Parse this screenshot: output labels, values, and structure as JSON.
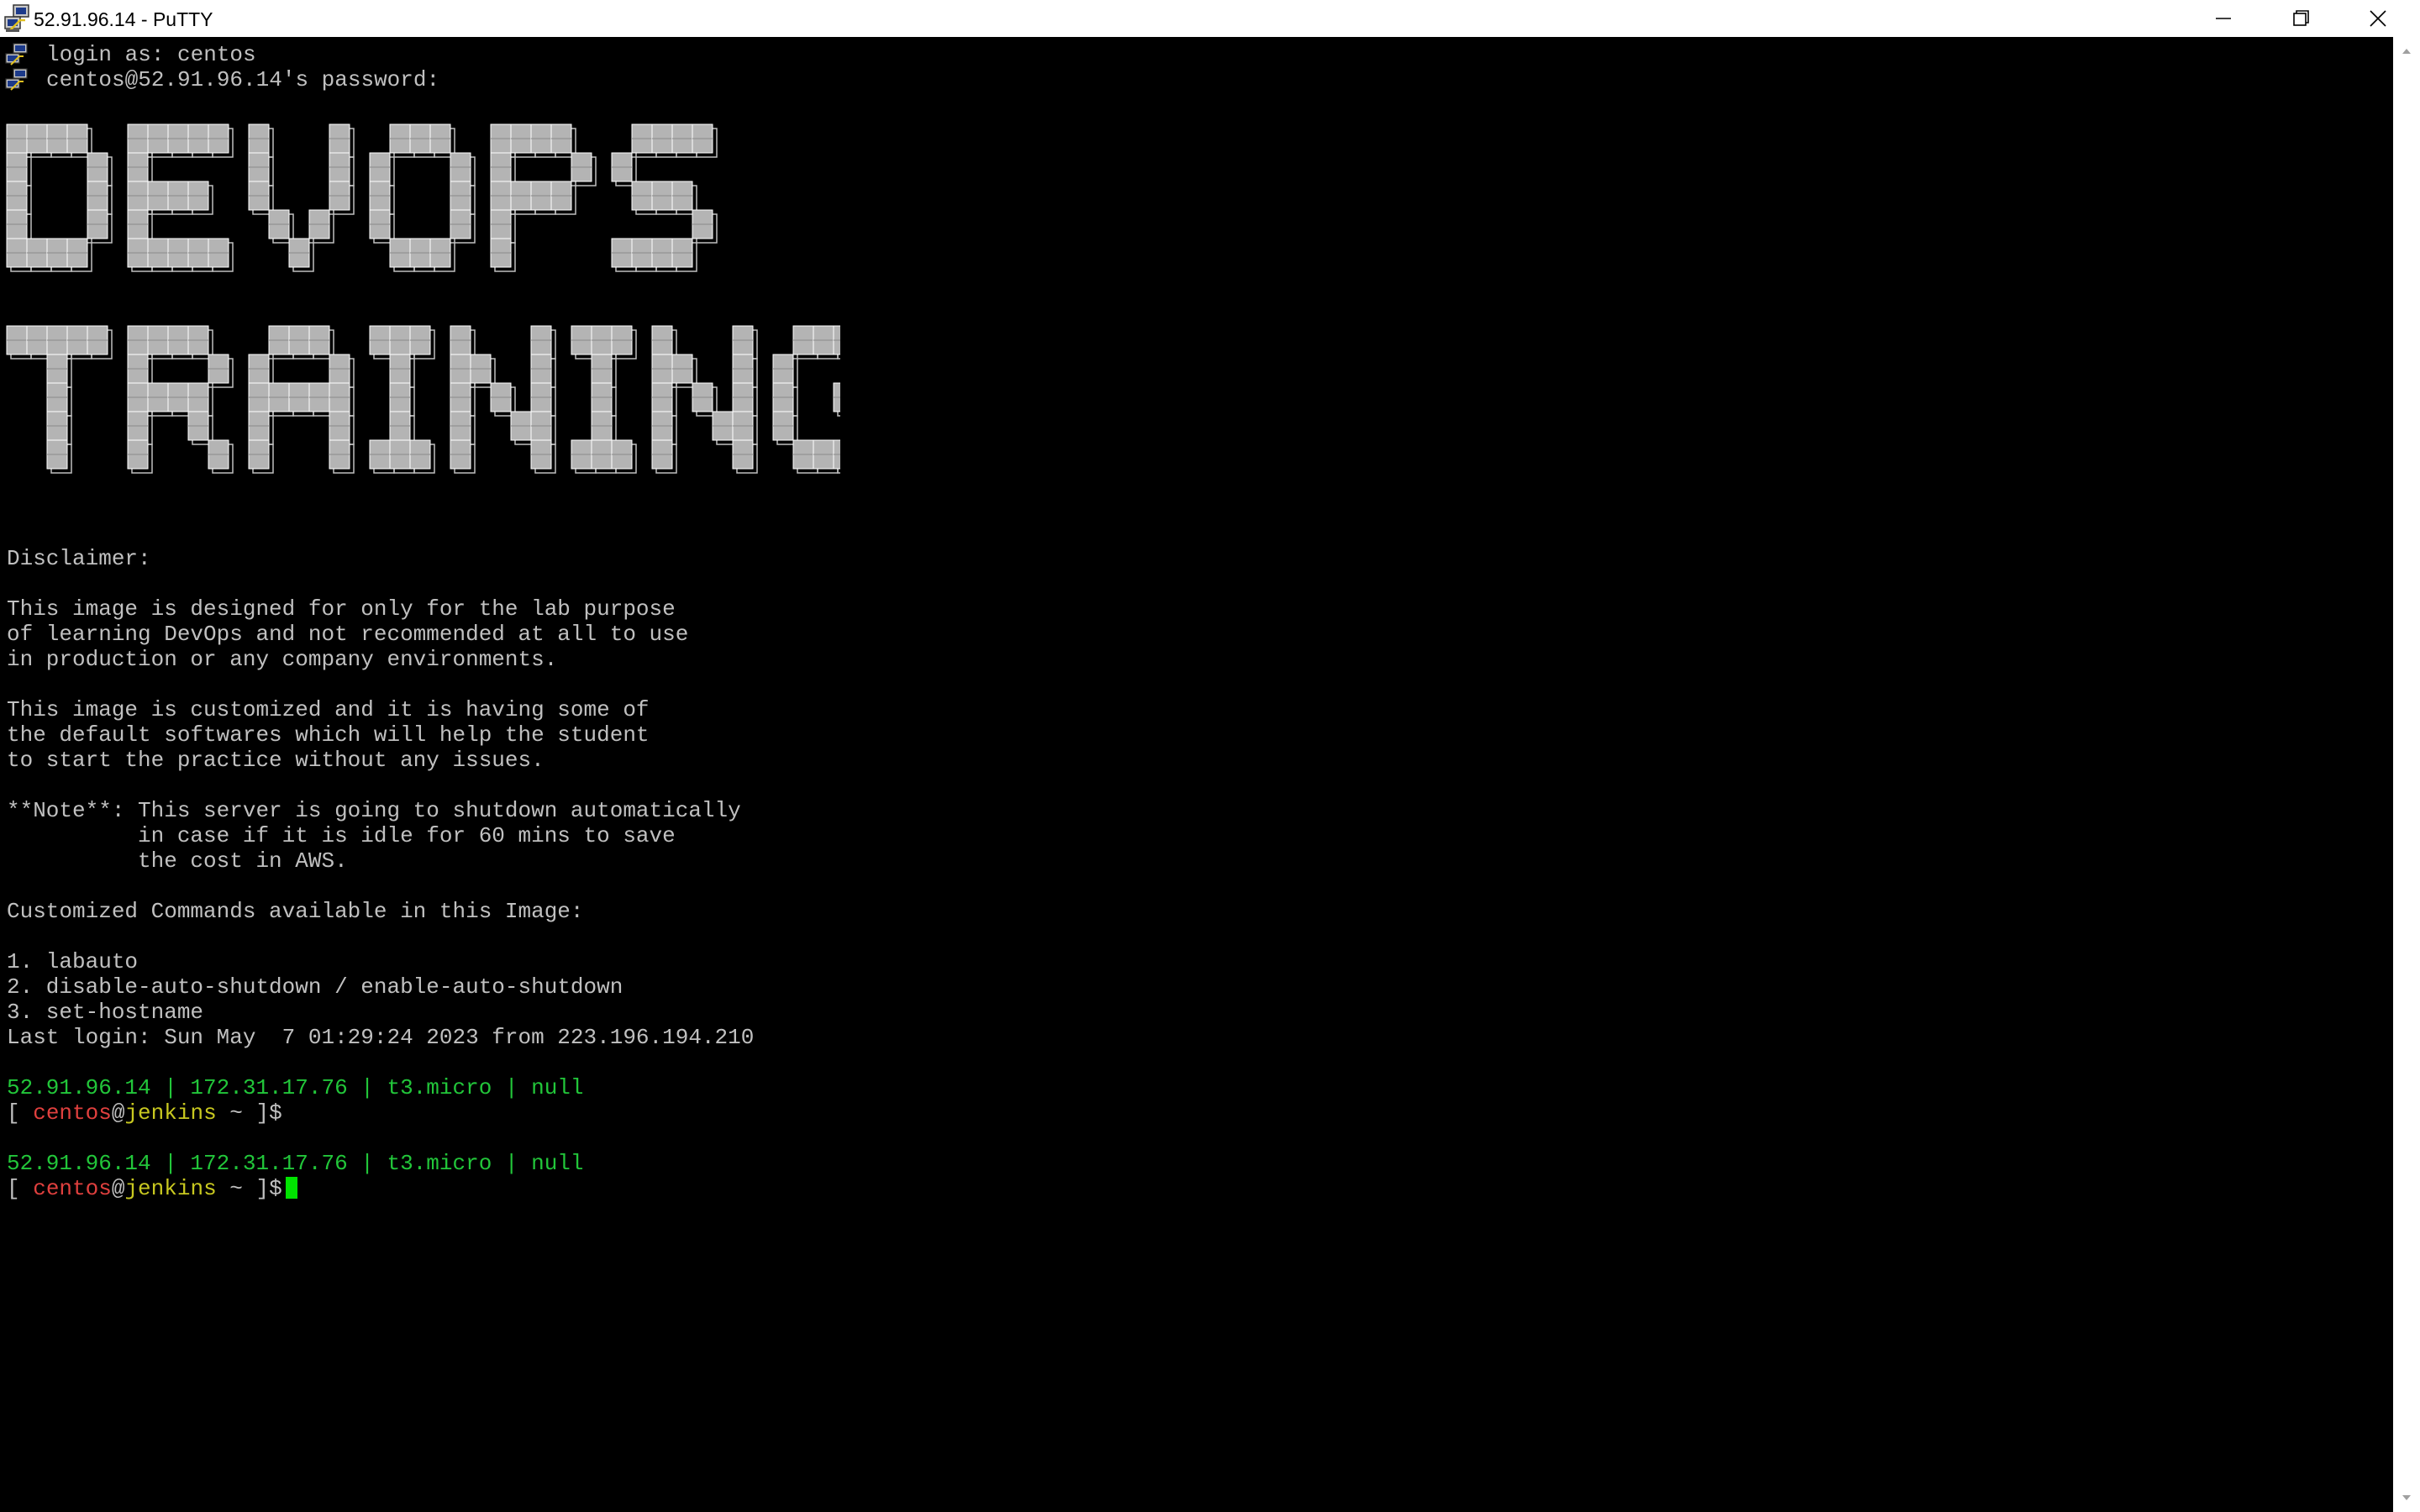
{
  "window": {
    "title": "52.91.96.14 - PuTTY",
    "controls": {
      "minimize": "minimize",
      "maximize": "restore",
      "close": "close"
    }
  },
  "colors": {
    "terminal_bg": "#000000",
    "terminal_text": "#c0c0c0",
    "green": "#22c63a",
    "red": "#e0403e",
    "yellow": "#c8c820",
    "cursor": "#00e400",
    "titlebar_bg": "#ffffff"
  },
  "terminal": {
    "login_prompt": "login as: centos",
    "password_prompt": "centos@52.91.96.14's password:",
    "banner_lines": [
      "DEVOPS",
      "TRAINING"
    ],
    "disclaimer_title": "Disclaimer:",
    "disclaimer_p1": [
      "This image is designed for only for the lab purpose",
      "of learning DevOps and not recommended at all to use",
      "in production or any company environments."
    ],
    "disclaimer_p2": [
      "This image is customized and it is having some of",
      "the default softwares which will help the student",
      "to start the practice without any issues."
    ],
    "note": [
      "**Note**: This server is going to shutdown automatically",
      "          in case if it is idle for 60 mins to save",
      "          the cost in AWS."
    ],
    "commands_title": "Customized Commands available in this Image:",
    "commands": [
      "1. labauto",
      "2. disable-auto-shutdown / enable-auto-shutdown",
      "3. set-hostname"
    ],
    "last_login": "Last login: Sun May  7 01:29:24 2023 from 223.196.194.210",
    "status_line": "52.91.96.14 | 172.31.17.76 | t3.micro | null",
    "prompt": {
      "open": "[ ",
      "user": "centos",
      "at": "@",
      "host": "jenkins",
      "tail": " ~ ]$"
    }
  }
}
